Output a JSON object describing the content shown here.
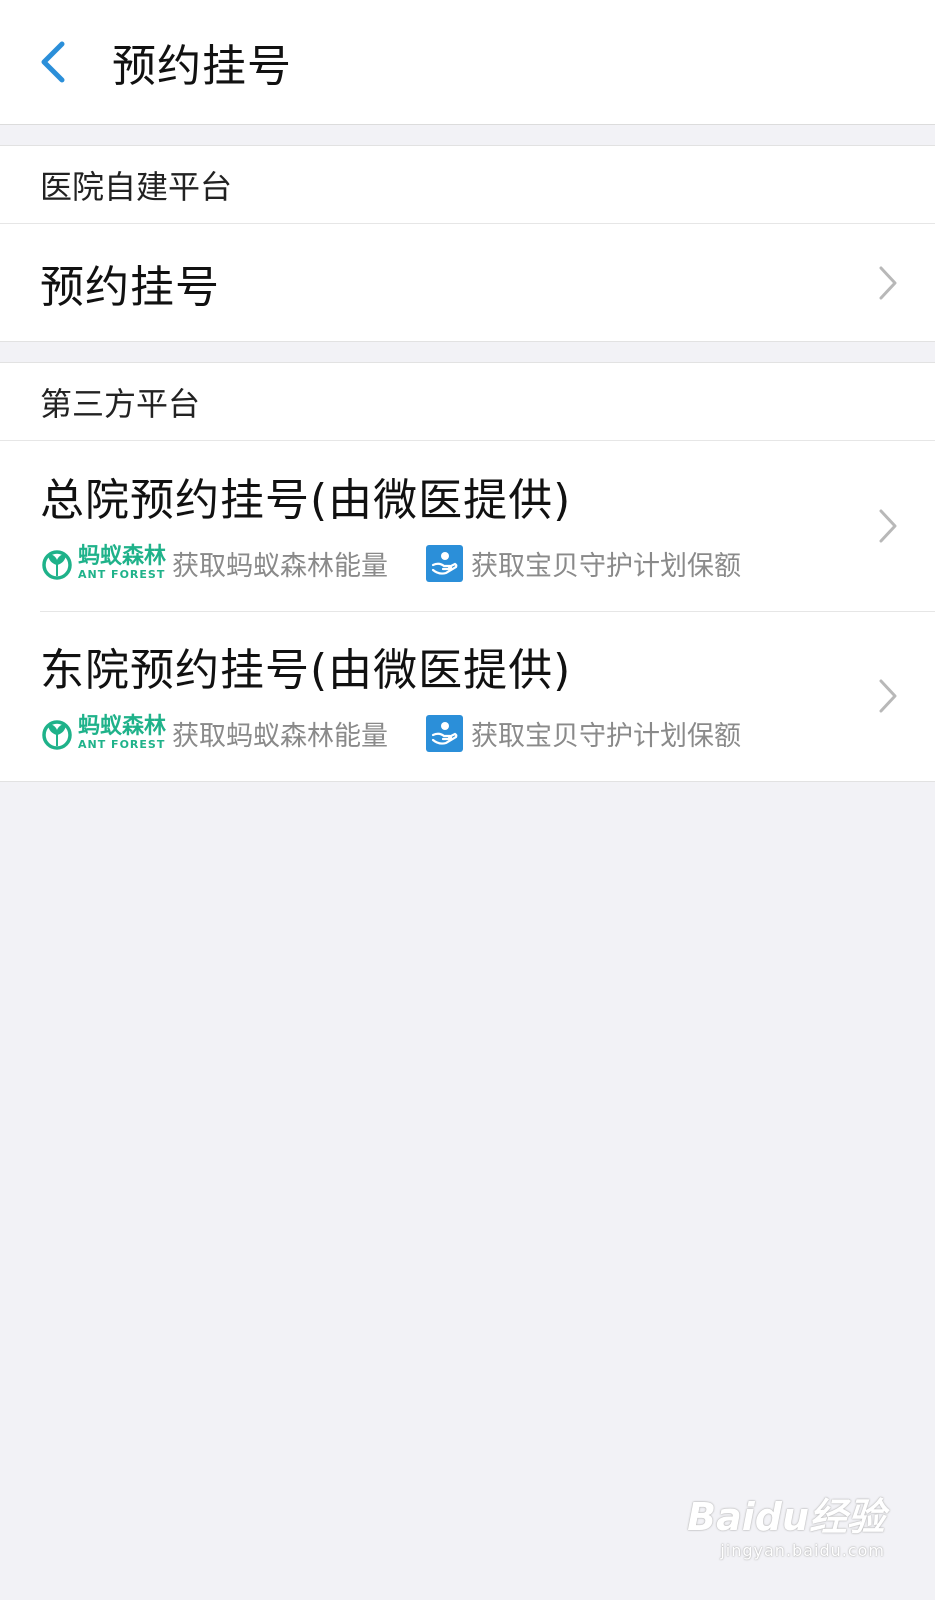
{
  "header": {
    "title": "预约挂号",
    "back_icon": "chevron-left-icon"
  },
  "sections": [
    {
      "header": "医院自建平台",
      "items": [
        {
          "title": "预约挂号"
        }
      ]
    },
    {
      "header": "第三方平台",
      "items": [
        {
          "title": "总院预约挂号(由微医提供)",
          "tag1_text": "获取蚂蚁森林能量",
          "tag2_text": "获取宝贝守护计划保额"
        },
        {
          "title": "东院预约挂号(由微医提供)",
          "tag1_text": "获取蚂蚁森林能量",
          "tag2_text": "获取宝贝守护计划保额"
        }
      ]
    }
  ],
  "ant_forest_logo": {
    "cn": "蚂蚁森林",
    "en": "ANT FOREST"
  },
  "watermark": {
    "main": "Baidu经验",
    "sub": "jingyan.baidu.com"
  },
  "colors": {
    "accent": "#2b8fd9",
    "ant_green": "#1fb28a",
    "background": "#f2f2f6"
  }
}
